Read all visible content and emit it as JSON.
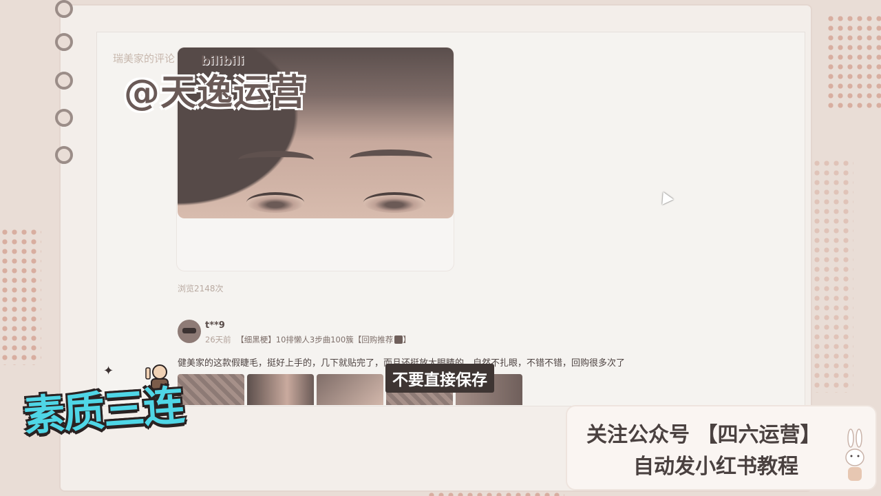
{
  "overlay": {
    "watermark": "@天逸运营",
    "bilibili_logo": "bilibili",
    "faint_header": "瑞美家的评论",
    "subtitle": "不要直接保存",
    "promo_line1": "关注公众号 【四六运营】",
    "promo_line2": "自动发小红书教程",
    "sticker_text": "素质三连"
  },
  "post": {
    "views_text": "浏览2148次"
  },
  "review": {
    "username": "t**9",
    "time_ago": "26天前",
    "meta_text": "【细黑梗】10排懒人3步曲100簇【回购推荐",
    "meta_end": "】",
    "body": "健美家的这款假睫毛，挺好上手的，几下就贴完了，而且还挺放大眼睛的，自然不扎眼，不错不错，回购很多次了"
  },
  "colors": {
    "background": "#e9ddd6",
    "accent_dots": "#d6a99a",
    "sticker": "#4fd6e6",
    "text_dark": "#4a4140"
  }
}
